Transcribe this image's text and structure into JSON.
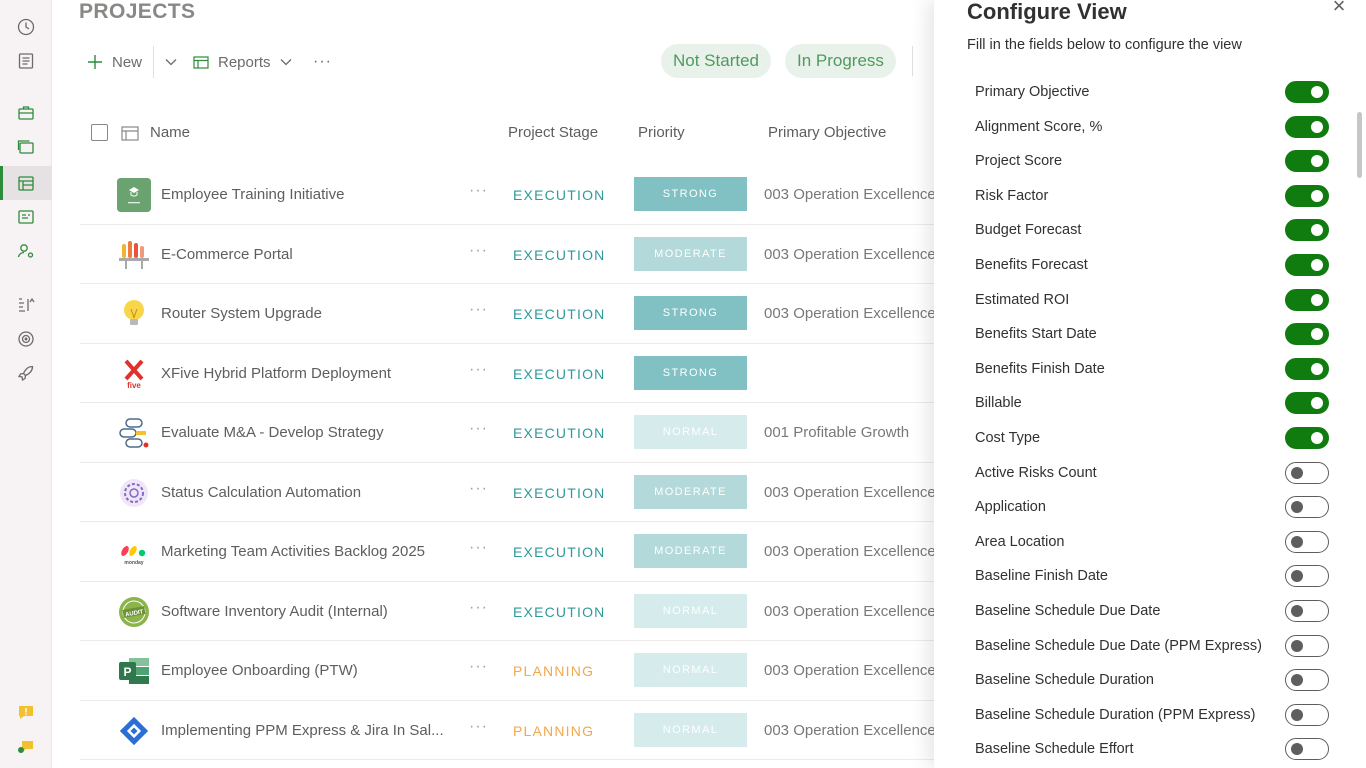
{
  "page": {
    "title": "PROJECTS"
  },
  "toolbar": {
    "new_label": "New",
    "reports_label": "Reports",
    "more_label": "···"
  },
  "filters": [
    {
      "label": "Not Started"
    },
    {
      "label": "In Progress"
    }
  ],
  "columns": {
    "name": "Name",
    "stage": "Project Stage",
    "priority": "Priority",
    "objective": "Primary Objective"
  },
  "projects": [
    {
      "name": "Employee Training Initiative",
      "stage": "EXECUTION",
      "priority": "STRONG",
      "objective": "003 Operation Excellence",
      "icon": "training-icon"
    },
    {
      "name": "E-Commerce Portal",
      "stage": "EXECUTION",
      "priority": "MODERATE",
      "objective": "003 Operation Excellence",
      "icon": "portal-icon"
    },
    {
      "name": "Router System Upgrade",
      "stage": "EXECUTION",
      "priority": "STRONG",
      "objective": "003 Operation Excellence",
      "icon": "lightbulb-icon"
    },
    {
      "name": "XFive Hybrid Platform Deployment",
      "stage": "EXECUTION",
      "priority": "STRONG",
      "objective": "",
      "icon": "xfive-logo-icon"
    },
    {
      "name": "Evaluate M&A - Develop Strategy",
      "stage": "EXECUTION",
      "priority": "NORMAL",
      "objective": "001 Profitable Growth",
      "icon": "strategy-icon"
    },
    {
      "name": "Status Calculation Automation",
      "stage": "EXECUTION",
      "priority": "MODERATE",
      "objective": "003 Operation Excellence",
      "icon": "gear-brain-icon"
    },
    {
      "name": "Marketing Team Activities Backlog 2025",
      "stage": "EXECUTION",
      "priority": "MODERATE",
      "objective": "003 Operation Excellence",
      "icon": "monday-logo-icon"
    },
    {
      "name": "Software Inventory Audit (Internal)",
      "stage": "EXECUTION",
      "priority": "NORMAL",
      "objective": "003 Operation Excellence",
      "icon": "audit-stamp-icon"
    },
    {
      "name": "Employee Onboarding (PTW)",
      "stage": "PLANNING",
      "priority": "NORMAL",
      "objective": "003 Operation Excellence",
      "icon": "project-logo-icon"
    },
    {
      "name": "Implementing PPM Express & Jira In Sal...",
      "stage": "PLANNING",
      "priority": "NORMAL",
      "objective": "003 Operation Excellence",
      "icon": "jira-logo-icon"
    }
  ],
  "panel": {
    "title": "Configure View",
    "subtitle": "Fill in the fields below to configure the view",
    "fields": [
      {
        "label": "Primary Objective",
        "on": true
      },
      {
        "label": "Alignment Score, %",
        "on": true
      },
      {
        "label": "Project Score",
        "on": true
      },
      {
        "label": "Risk Factor",
        "on": true
      },
      {
        "label": "Budget Forecast",
        "on": true
      },
      {
        "label": "Benefits Forecast",
        "on": true
      },
      {
        "label": "Estimated ROI",
        "on": true
      },
      {
        "label": "Benefits Start Date",
        "on": true
      },
      {
        "label": "Benefits Finish Date",
        "on": true
      },
      {
        "label": "Billable",
        "on": true
      },
      {
        "label": "Cost Type",
        "on": true
      },
      {
        "label": "Active Risks Count",
        "on": false
      },
      {
        "label": "Application",
        "on": false
      },
      {
        "label": "Area Location",
        "on": false
      },
      {
        "label": "Baseline Finish Date",
        "on": false
      },
      {
        "label": "Baseline Schedule Due Date",
        "on": false
      },
      {
        "label": "Baseline Schedule Due Date (PPM Express)",
        "on": false
      },
      {
        "label": "Baseline Schedule Duration",
        "on": false
      },
      {
        "label": "Baseline Schedule Duration (PPM Express)",
        "on": false
      },
      {
        "label": "Baseline Schedule Effort",
        "on": false
      }
    ]
  },
  "colors": {
    "accent": "#107c10",
    "execution": "#2e9a9b",
    "planning": "#f2a84b",
    "pill_bg": "#e8f2ea"
  }
}
